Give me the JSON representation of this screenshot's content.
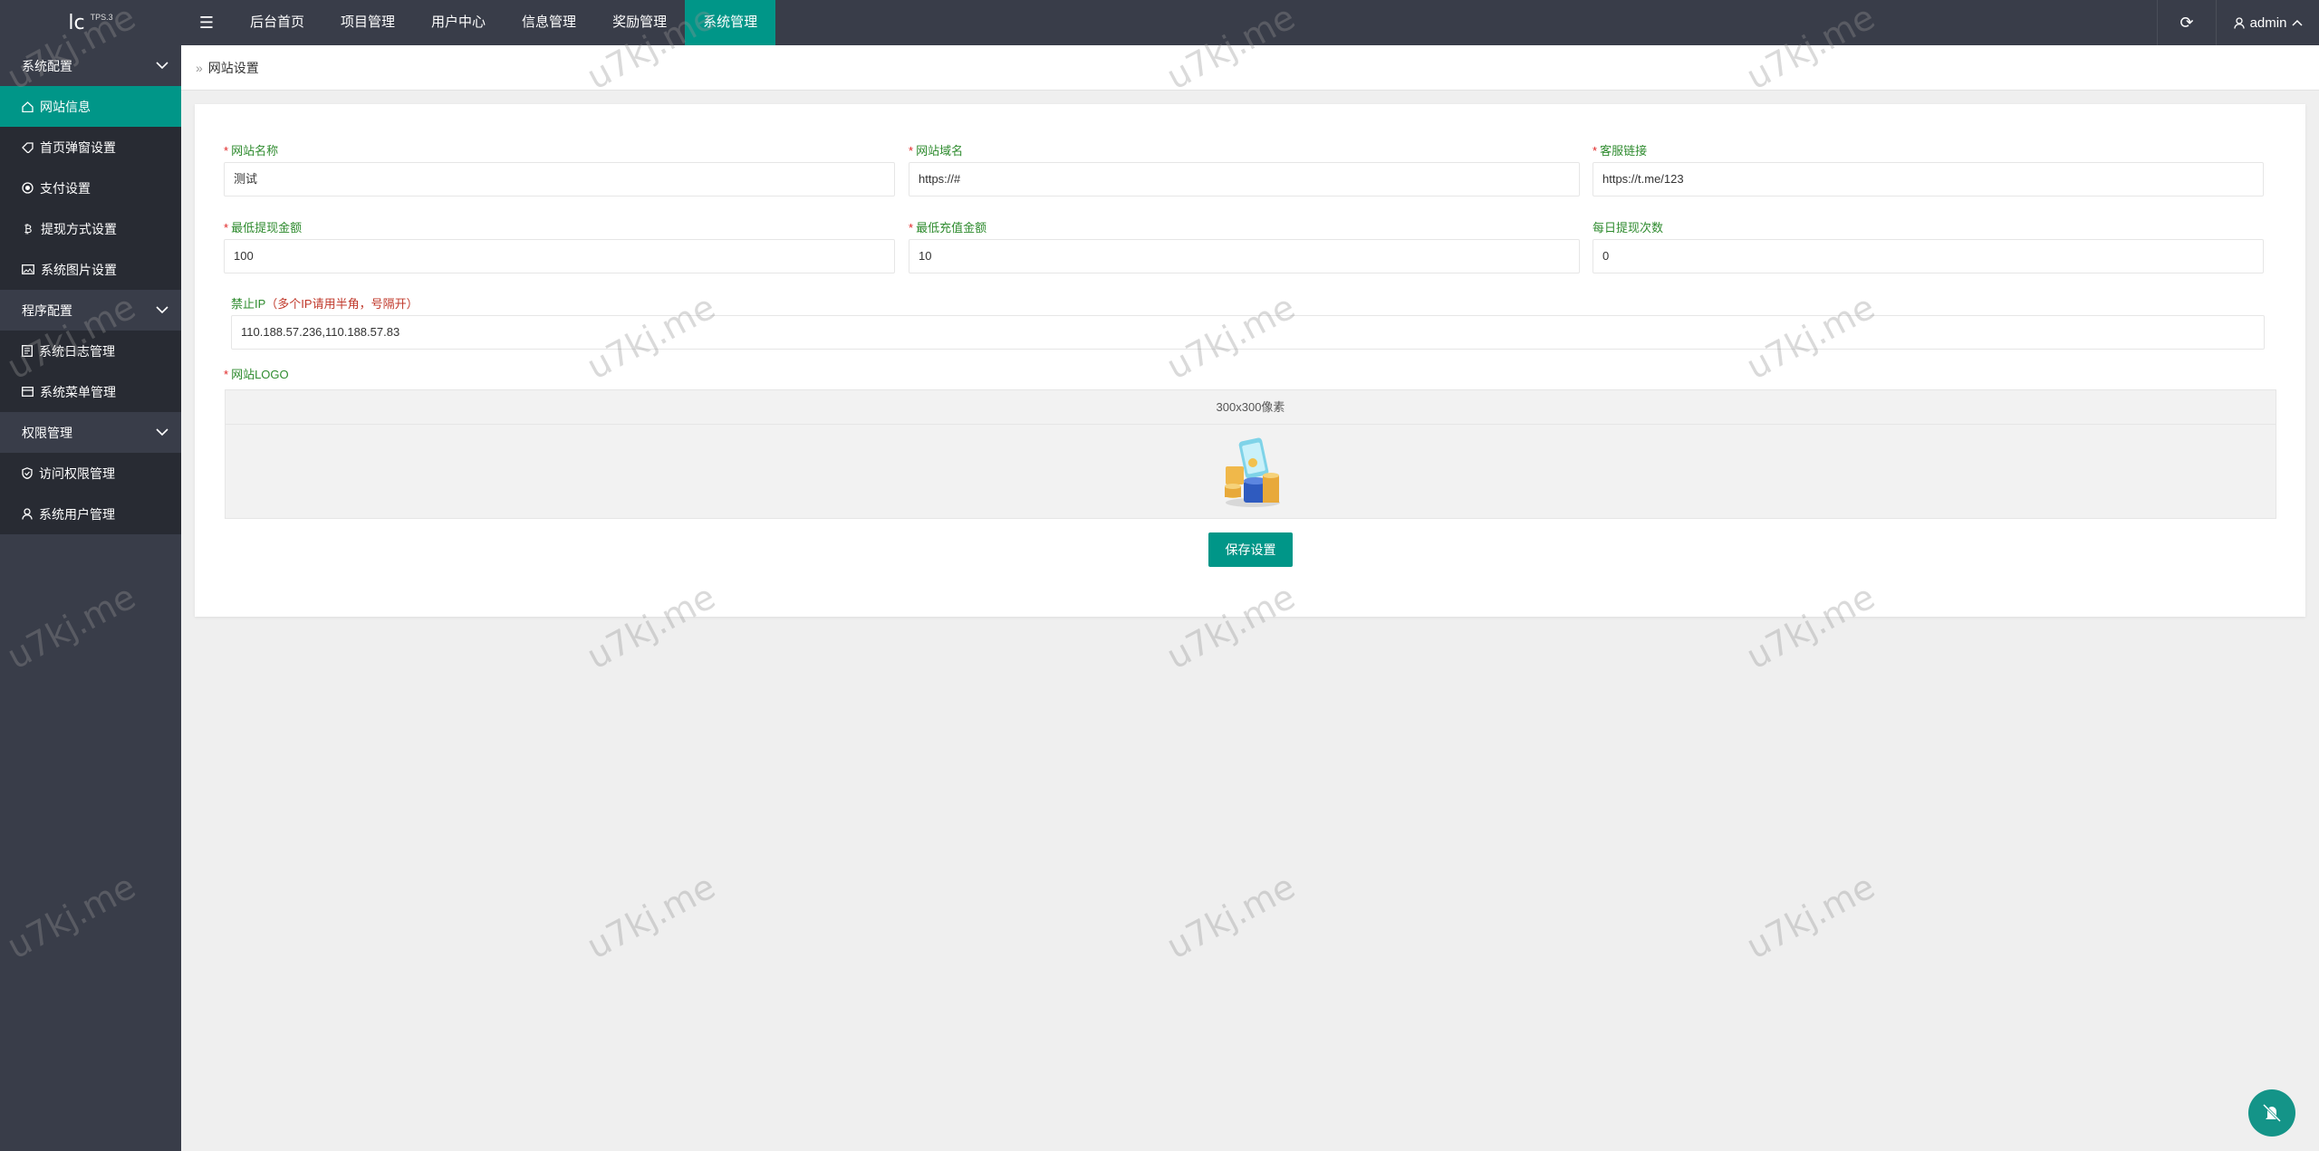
{
  "header": {
    "logo_text": "lc",
    "version": "TPS.3",
    "nav": [
      "后台首页",
      "项目管理",
      "用户中心",
      "信息管理",
      "奖励管理",
      "系统管理"
    ],
    "active_nav": "系统管理",
    "user": "admin"
  },
  "sidebar": {
    "groups": [
      {
        "title": "系统配置",
        "items": [
          "网站信息",
          "首页弹窗设置",
          "支付设置",
          "提现方式设置",
          "系统图片设置"
        ]
      },
      {
        "title": "程序配置",
        "items": [
          "系统日志管理",
          "系统菜单管理"
        ]
      },
      {
        "title": "权限管理",
        "items": [
          "访问权限管理",
          "系统用户管理"
        ]
      }
    ],
    "active_item": "网站信息"
  },
  "breadcrumb": {
    "sep": "»",
    "current": "网站设置"
  },
  "form": {
    "site_name": {
      "label": "网站名称",
      "value": "测试"
    },
    "site_domain": {
      "label": "网站域名",
      "value": "https://#"
    },
    "service_link": {
      "label": "客服链接",
      "value": "https://t.me/123"
    },
    "min_withdraw": {
      "label": "最低提现金额",
      "value": "100"
    },
    "min_recharge": {
      "label": "最低充值金额",
      "value": "10"
    },
    "daily_withdraw_times": {
      "label": "每日提现次数",
      "value": "0"
    },
    "banned_ip": {
      "label": "禁止IP",
      "hint": "（多个IP请用半角，号隔开）",
      "value": "110.188.57.236,110.188.57.83"
    },
    "site_logo": {
      "label": "网站LOGO",
      "size_hint": "300x300像素"
    },
    "save_label": "保存设置"
  },
  "watermark": "u7kj.me",
  "colors": {
    "accent": "#009688",
    "dark": "#393d49",
    "required": "#e02424",
    "label": "#2e8b2e"
  }
}
